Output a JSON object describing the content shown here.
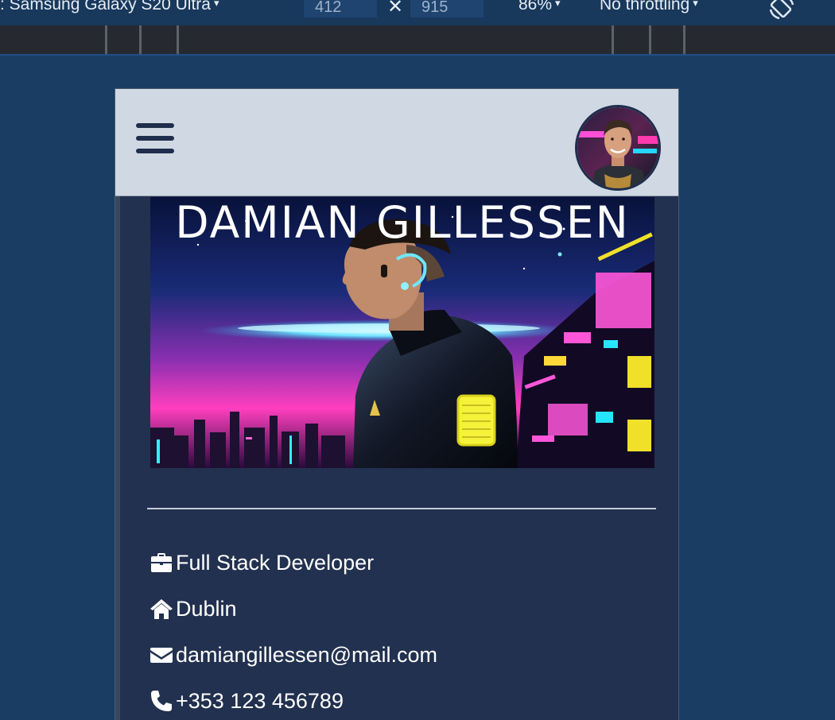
{
  "devtools": {
    "device": ": Samsung Galaxy S20 Ultra",
    "width": "412",
    "height": "915",
    "zoom": "86%",
    "throttling": "No throttling",
    "caret": "▾",
    "times": "✕"
  },
  "header": {
    "menu_icon": "hamburger-icon",
    "avatar_icon": "profile-photo"
  },
  "hero": {
    "title": "DAMIAN GILLESSEN"
  },
  "contact": [
    {
      "icon": "briefcase-icon",
      "text": "Full Stack Developer"
    },
    {
      "icon": "home-icon",
      "text": "Dublin"
    },
    {
      "icon": "envelope-icon",
      "text": "damiangillessen@mail.com"
    },
    {
      "icon": "phone-icon",
      "text": "+353 123 456789"
    }
  ],
  "colors": {
    "page_background": "#1a3d64",
    "header_background": "#d0d9e3",
    "content_background": "#22314f",
    "text": "#ffffff"
  }
}
